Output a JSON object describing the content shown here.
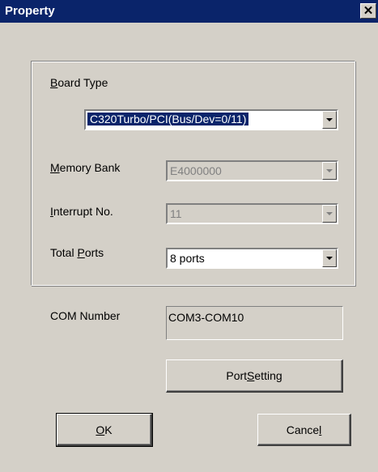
{
  "window": {
    "title": "Property",
    "close_symbol": "✕"
  },
  "board_type": {
    "label_pre": "",
    "label_mnemonic": "B",
    "label_post": "oard Type",
    "value": "C320Turbo/PCI(Bus/Dev=0/11)"
  },
  "memory_bank": {
    "label_mnemonic": "M",
    "label_post": "emory Bank",
    "value": "E4000000"
  },
  "interrupt": {
    "label_mnemonic": "I",
    "label_post": "nterrupt No.",
    "value": "11"
  },
  "total_ports": {
    "label_pre": "Total ",
    "label_mnemonic": "P",
    "label_post": "orts",
    "value": "8 ports"
  },
  "com_number": {
    "label": "COM Number",
    "value": "COM3-COM10"
  },
  "port_setting_button": {
    "label_pre": "Port ",
    "label_mnemonic": "S",
    "label_post": "etting"
  },
  "ok_button": {
    "label_mnemonic": "O",
    "label_post": "K"
  },
  "cancel_button": {
    "label_pre": "Cance",
    "label_mnemonic": "l"
  },
  "icons": {
    "dropdown": "chevron-down-icon",
    "close": "close-icon"
  },
  "colors": {
    "titlebar": "#0a246a",
    "face": "#d4d0c8",
    "selection": "#0a246a"
  }
}
